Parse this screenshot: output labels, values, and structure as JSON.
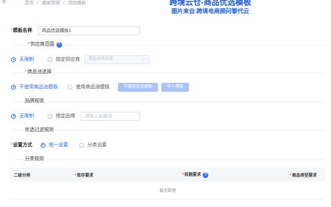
{
  "topbar": {
    "close_glyph": "×",
    "breadcrumb": [
      "首页",
      "模板管理",
      "添加模板"
    ]
  },
  "banner": {
    "line1": "跨境云仓-商品优选模板",
    "line2": "图片来自 跨境电商顾问黎代云"
  },
  "form": {
    "template_name": {
      "label": "模板名称",
      "value": "商品优选模板1"
    },
    "supplier_scope": {
      "section": "供应商范围",
      "options": [
        "无限制",
        "指定供应商"
      ],
      "selected": 0,
      "select_placeholder": "请选择供应商"
    },
    "product_pool": {
      "section": "商品池选择",
      "options": [
        "不使用商品池模板",
        "使用商品池模板"
      ],
      "selected": 0,
      "buttons": [
        "下载商品池模板",
        "导入模板"
      ]
    },
    "brand_rule": {
      "section": "品牌规则",
      "options": [
        "无限制",
        "指定品牌"
      ],
      "selected": 0,
      "input_placeholder": "请输入关键词"
    },
    "filter_rule": {
      "section": "优选过滤规则"
    },
    "setting_mode": {
      "label": "设置方式",
      "options": [
        "统一设置",
        "分类设置"
      ],
      "selected": 0
    },
    "category_rule": {
      "section": "分类规则"
    }
  },
  "table": {
    "columns": [
      "二级分类",
      "库存要求",
      "效期要求",
      "商品类型要求"
    ],
    "required": [
      false,
      true,
      true,
      true
    ],
    "empty_text": "暂无数据"
  },
  "colors": {
    "primary": "#2f6bf0",
    "required": "#e5484d",
    "banner": "#1f5bd6"
  },
  "icons": {
    "help": "question-circle-icon",
    "select_arrow": "chevron-down-icon",
    "close": "close-icon"
  }
}
